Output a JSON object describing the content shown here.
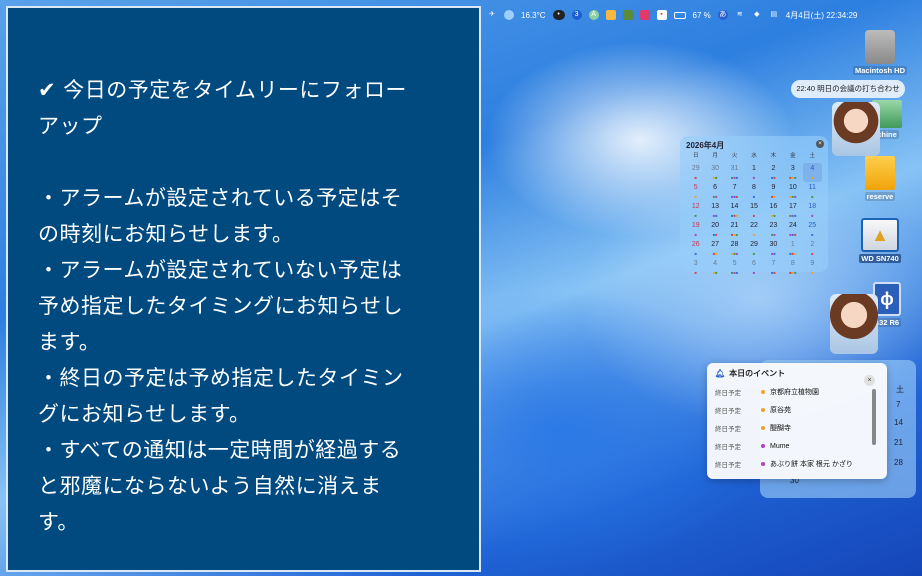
{
  "panel": {
    "lines": [
      "✔ 今日の予定をタイムリーにフォロー",
      "アップ",
      "",
      "・アラームが設定されている予定はそ",
      "の時刻にお知らせします。",
      "・アラームが設定されていない予定は",
      "予め指定したタイミングにお知らせし",
      "ます。",
      "・終日の予定は予め指定したタイミン",
      "グにお知らせします。",
      "・すべての通知は一定時間が経過する",
      "と邪魔にならないよう自然に消えま",
      "す。"
    ]
  },
  "menubar": {
    "temperature": "16.3°C",
    "badge": "3",
    "battery": "67 %",
    "input": "あ",
    "clock": "4月4日(土) 22:34:29"
  },
  "desktop": {
    "icons": [
      "Macintosh HD",
      "chine",
      "reserve",
      "WD SN740",
      "s32 R6"
    ]
  },
  "notification": {
    "text": "22:40 明日の会議の打ち合わせ"
  },
  "calendar": {
    "title": "2026年4月",
    "weekdays": [
      "日",
      "月",
      "火",
      "水",
      "木",
      "金",
      "土"
    ],
    "rows": [
      [
        "29",
        "30",
        "31",
        "1",
        "2",
        "3",
        "4"
      ],
      [
        "5",
        "6",
        "7",
        "8",
        "9",
        "10",
        "11"
      ],
      [
        "12",
        "13",
        "14",
        "15",
        "16",
        "17",
        "18"
      ],
      [
        "19",
        "20",
        "21",
        "22",
        "23",
        "24",
        "25"
      ],
      [
        "26",
        "27",
        "28",
        "29",
        "30",
        "1",
        "2"
      ],
      [
        "3",
        "4",
        "5",
        "6",
        "7",
        "8",
        "9"
      ]
    ]
  },
  "back_calendar": {
    "header": "土",
    "numbers": [
      "7",
      "14",
      "21",
      "28",
      "30"
    ]
  },
  "events": {
    "title": "本日のイベント",
    "items": [
      {
        "kind": "終日予定",
        "name": "京都府立植物園",
        "color": "#f0a030"
      },
      {
        "kind": "終日予定",
        "name": "原谷苑",
        "color": "#f0a030"
      },
      {
        "kind": "終日予定",
        "name": "醍醐寺",
        "color": "#f0a030"
      },
      {
        "kind": "終日予定",
        "name": "Mume",
        "color": "#b040c0"
      },
      {
        "kind": "終日予定",
        "name": "あぶり餅 本家 根元 かざり",
        "color": "#b040c0"
      }
    ]
  }
}
